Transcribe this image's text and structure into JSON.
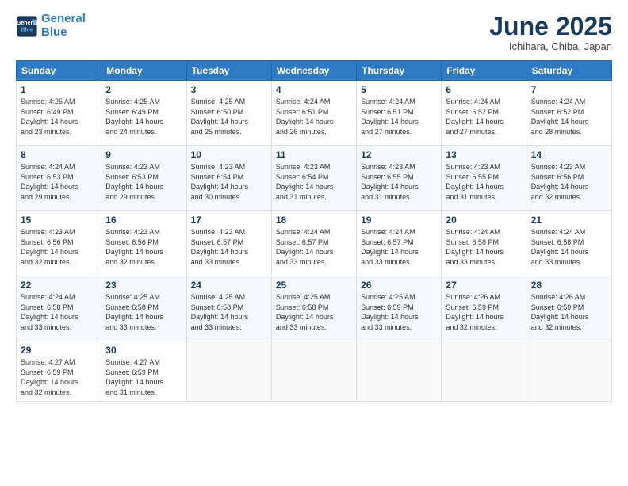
{
  "header": {
    "logo_line1": "General",
    "logo_line2": "Blue",
    "month_year": "June 2025",
    "location": "Ichihara, Chiba, Japan"
  },
  "weekdays": [
    "Sunday",
    "Monday",
    "Tuesday",
    "Wednesday",
    "Thursday",
    "Friday",
    "Saturday"
  ],
  "weeks": [
    [
      {
        "day": "1",
        "info": "Sunrise: 4:25 AM\nSunset: 6:49 PM\nDaylight: 14 hours\nand 23 minutes."
      },
      {
        "day": "2",
        "info": "Sunrise: 4:25 AM\nSunset: 6:49 PM\nDaylight: 14 hours\nand 24 minutes."
      },
      {
        "day": "3",
        "info": "Sunrise: 4:25 AM\nSunset: 6:50 PM\nDaylight: 14 hours\nand 25 minutes."
      },
      {
        "day": "4",
        "info": "Sunrise: 4:24 AM\nSunset: 6:51 PM\nDaylight: 14 hours\nand 26 minutes."
      },
      {
        "day": "5",
        "info": "Sunrise: 4:24 AM\nSunset: 6:51 PM\nDaylight: 14 hours\nand 27 minutes."
      },
      {
        "day": "6",
        "info": "Sunrise: 4:24 AM\nSunset: 6:52 PM\nDaylight: 14 hours\nand 27 minutes."
      },
      {
        "day": "7",
        "info": "Sunrise: 4:24 AM\nSunset: 6:52 PM\nDaylight: 14 hours\nand 28 minutes."
      }
    ],
    [
      {
        "day": "8",
        "info": "Sunrise: 4:24 AM\nSunset: 6:53 PM\nDaylight: 14 hours\nand 29 minutes."
      },
      {
        "day": "9",
        "info": "Sunrise: 4:23 AM\nSunset: 6:53 PM\nDaylight: 14 hours\nand 29 minutes."
      },
      {
        "day": "10",
        "info": "Sunrise: 4:23 AM\nSunset: 6:54 PM\nDaylight: 14 hours\nand 30 minutes."
      },
      {
        "day": "11",
        "info": "Sunrise: 4:23 AM\nSunset: 6:54 PM\nDaylight: 14 hours\nand 31 minutes."
      },
      {
        "day": "12",
        "info": "Sunrise: 4:23 AM\nSunset: 6:55 PM\nDaylight: 14 hours\nand 31 minutes."
      },
      {
        "day": "13",
        "info": "Sunrise: 4:23 AM\nSunset: 6:55 PM\nDaylight: 14 hours\nand 31 minutes."
      },
      {
        "day": "14",
        "info": "Sunrise: 4:23 AM\nSunset: 6:56 PM\nDaylight: 14 hours\nand 32 minutes."
      }
    ],
    [
      {
        "day": "15",
        "info": "Sunrise: 4:23 AM\nSunset: 6:56 PM\nDaylight: 14 hours\nand 32 minutes."
      },
      {
        "day": "16",
        "info": "Sunrise: 4:23 AM\nSunset: 6:56 PM\nDaylight: 14 hours\nand 32 minutes."
      },
      {
        "day": "17",
        "info": "Sunrise: 4:23 AM\nSunset: 6:57 PM\nDaylight: 14 hours\nand 33 minutes."
      },
      {
        "day": "18",
        "info": "Sunrise: 4:24 AM\nSunset: 6:57 PM\nDaylight: 14 hours\nand 33 minutes."
      },
      {
        "day": "19",
        "info": "Sunrise: 4:24 AM\nSunset: 6:57 PM\nDaylight: 14 hours\nand 33 minutes."
      },
      {
        "day": "20",
        "info": "Sunrise: 4:24 AM\nSunset: 6:58 PM\nDaylight: 14 hours\nand 33 minutes."
      },
      {
        "day": "21",
        "info": "Sunrise: 4:24 AM\nSunset: 6:58 PM\nDaylight: 14 hours\nand 33 minutes."
      }
    ],
    [
      {
        "day": "22",
        "info": "Sunrise: 4:24 AM\nSunset: 6:58 PM\nDaylight: 14 hours\nand 33 minutes."
      },
      {
        "day": "23",
        "info": "Sunrise: 4:25 AM\nSunset: 6:58 PM\nDaylight: 14 hours\nand 33 minutes."
      },
      {
        "day": "24",
        "info": "Sunrise: 4:25 AM\nSunset: 6:58 PM\nDaylight: 14 hours\nand 33 minutes."
      },
      {
        "day": "25",
        "info": "Sunrise: 4:25 AM\nSunset: 6:58 PM\nDaylight: 14 hours\nand 33 minutes."
      },
      {
        "day": "26",
        "info": "Sunrise: 4:25 AM\nSunset: 6:59 PM\nDaylight: 14 hours\nand 33 minutes."
      },
      {
        "day": "27",
        "info": "Sunrise: 4:26 AM\nSunset: 6:59 PM\nDaylight: 14 hours\nand 32 minutes."
      },
      {
        "day": "28",
        "info": "Sunrise: 4:26 AM\nSunset: 6:59 PM\nDaylight: 14 hours\nand 32 minutes."
      }
    ],
    [
      {
        "day": "29",
        "info": "Sunrise: 4:27 AM\nSunset: 6:59 PM\nDaylight: 14 hours\nand 32 minutes."
      },
      {
        "day": "30",
        "info": "Sunrise: 4:27 AM\nSunset: 6:59 PM\nDaylight: 14 hours\nand 31 minutes."
      },
      {
        "day": "",
        "info": ""
      },
      {
        "day": "",
        "info": ""
      },
      {
        "day": "",
        "info": ""
      },
      {
        "day": "",
        "info": ""
      },
      {
        "day": "",
        "info": ""
      }
    ]
  ]
}
